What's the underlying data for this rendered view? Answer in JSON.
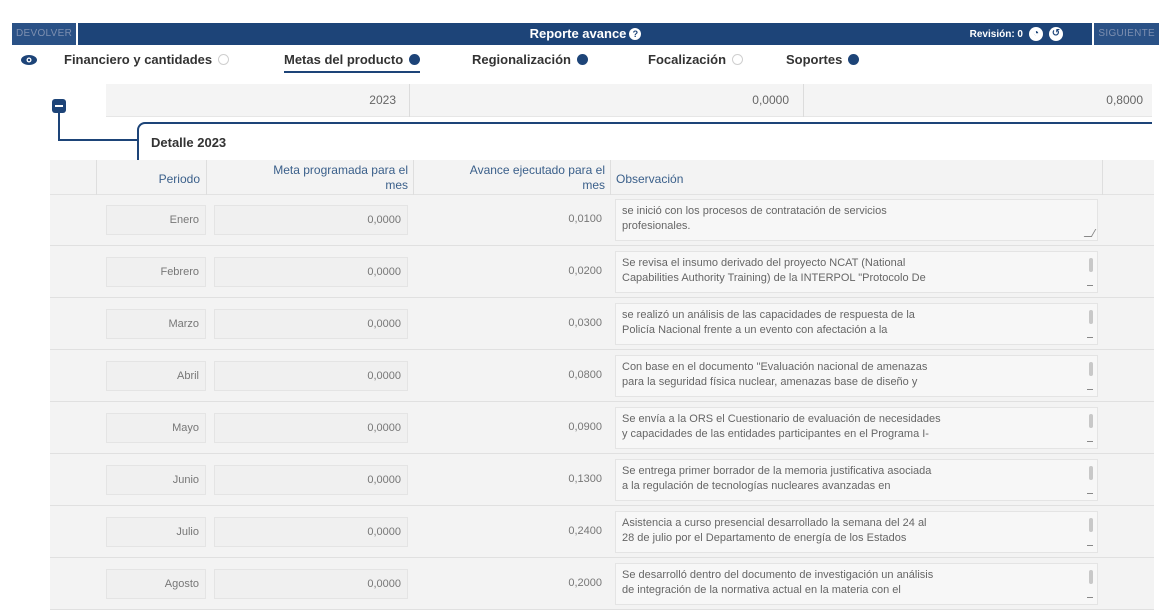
{
  "toolbar": {
    "devolver": "DEVOLVER",
    "title": "Reporte avance",
    "revision": "Revisión: 0",
    "siguiente": "SIGUIENTE"
  },
  "tabs": [
    {
      "label": "Financiero y cantidades",
      "status": "empty"
    },
    {
      "label": "Metas del producto",
      "status": "filled",
      "active": true
    },
    {
      "label": "Regionalización",
      "status": "filled"
    },
    {
      "label": "Focalización",
      "status": "empty"
    },
    {
      "label": "Soportes",
      "status": "filled"
    }
  ],
  "year_row": {
    "year": "2023",
    "value1": "0,0000",
    "value2": "0,8000"
  },
  "detail": {
    "title": "Detalle 2023",
    "headers": {
      "periodo": "Periodo",
      "meta_line1": "Meta programada para el",
      "meta_line2": "mes",
      "avance_line1": "Avance ejecutado para el",
      "avance_line2": "mes",
      "observacion": "Observación"
    },
    "rows": [
      {
        "periodo": "Enero",
        "meta": "0,0000",
        "avance": "0,0100",
        "obs1": "se inició con los procesos de contratación de servicios",
        "obs2": "profesionales."
      },
      {
        "periodo": "Febrero",
        "meta": "0,0000",
        "avance": "0,0200",
        "obs1": "Se revisa el insumo derivado del proyecto NCAT (National",
        "obs2": "Capabilities Authority Training) de la INTERPOL \"Protocolo De"
      },
      {
        "periodo": "Marzo",
        "meta": "0,0000",
        "avance": "0,0300",
        "obs1": "se realizó un análisis de las capacidades de respuesta de la",
        "obs2": "Policía Nacional frente a un evento con afectación a la"
      },
      {
        "periodo": "Abril",
        "meta": "0,0000",
        "avance": "0,0800",
        "obs1": "Con base en el documento \"Evaluación nacional de amenazas",
        "obs2": "para la seguridad física nuclear, amenazas base de diseño y"
      },
      {
        "periodo": "Mayo",
        "meta": "0,0000",
        "avance": "0,0900",
        "obs1": "Se envía a la ORS el Cuestionario de evaluación de necesidades",
        "obs2": "y capacidades de las entidades participantes en el Programa I-"
      },
      {
        "periodo": "Junio",
        "meta": "0,0000",
        "avance": "0,1300",
        "obs1": "Se entrega primer borrador de la memoria justificativa asociada",
        "obs2": "a la regulación de tecnologías nucleares avanzadas en"
      },
      {
        "periodo": "Julio",
        "meta": "0,0000",
        "avance": "0,2400",
        "obs1": "Asistencia a curso presencial desarrollado la semana del 24 al",
        "obs2": "28 de julio por el Departamento de energía de los Estados"
      },
      {
        "periodo": "Agosto",
        "meta": "0,0000",
        "avance": "0,2000",
        "obs1": "Se desarrolló dentro del documento de investigación un análisis",
        "obs2": "de integración de la normativa actual en la materia con el"
      }
    ]
  }
}
